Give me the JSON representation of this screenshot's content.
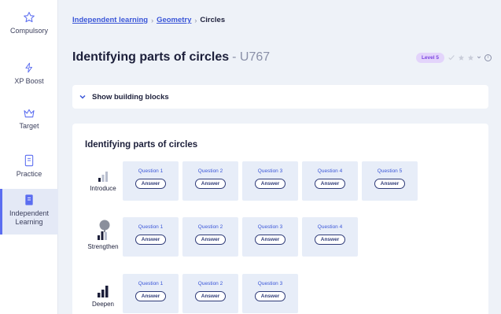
{
  "sidebar": {
    "items": [
      {
        "label": "Compulsory",
        "icon": "star-outline-icon"
      },
      {
        "label": "XP Boost",
        "icon": "lightning-icon"
      },
      {
        "label": "Target",
        "icon": "crown-icon"
      },
      {
        "label": "Practice",
        "icon": "book-icon"
      },
      {
        "label": "Independent Learning",
        "icon": "book-filled-icon",
        "active": true
      }
    ]
  },
  "breadcrumb": {
    "items": [
      "Independent learning",
      "Geometry",
      "Circles"
    ],
    "separator": "›"
  },
  "header": {
    "title": "Identifying parts of circles",
    "code": "- U767",
    "level_badge": "Level 5"
  },
  "building_blocks": {
    "label": "Show building blocks"
  },
  "panel": {
    "title": "Identifying parts of circles",
    "rows": [
      {
        "label": "Introduce",
        "questions": [
          "Question 1",
          "Question 2",
          "Question 3",
          "Question 4",
          "Question 5"
        ]
      },
      {
        "label": "Strengthen",
        "questions": [
          "Question 1",
          "Question 2",
          "Question 3",
          "Question 4"
        ]
      },
      {
        "label": "Deepen",
        "questions": [
          "Question 1",
          "Question 2",
          "Question 3"
        ]
      }
    ],
    "answer_label": "Answer"
  },
  "colors": {
    "accent": "#3a56d8",
    "card_bg": "#e7edf8",
    "badge_bg": "#e3d4fb",
    "badge_text": "#7b44e0"
  }
}
